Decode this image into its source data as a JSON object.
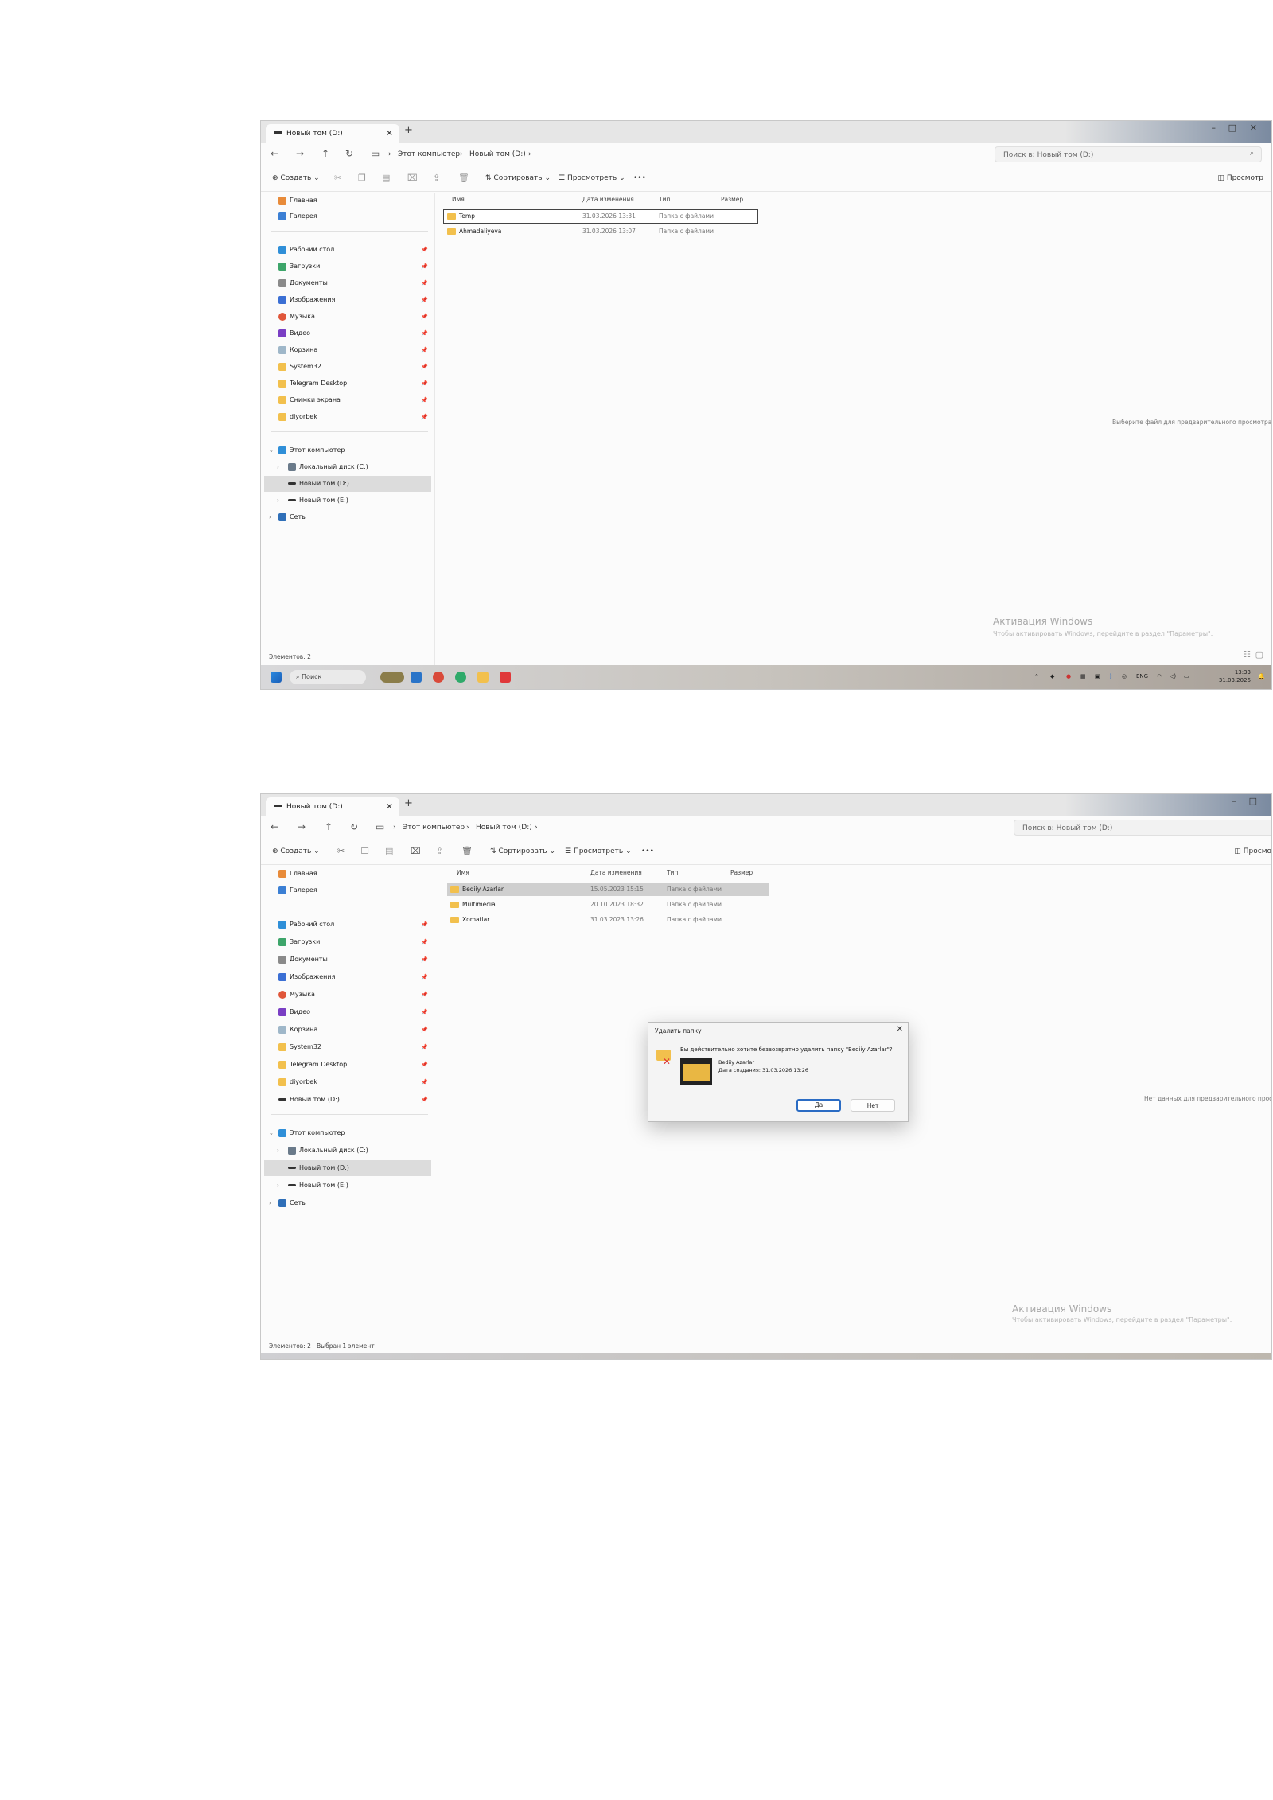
{
  "shot1": {
    "tab_title": "Новый том (D:)",
    "breadcrumb": [
      "Этот компьютер",
      "Новый том (D:)"
    ],
    "search_placeholder": "Поиск в: Новый том (D:)",
    "toolbar": {
      "create": "Создать",
      "sort": "Сортировать",
      "view": "Просмотреть",
      "more": "•••",
      "preview": "Просмотр"
    },
    "columns": {
      "name": "Имя",
      "date": "Дата изменения",
      "type": "Тип",
      "size": "Размер"
    },
    "files": [
      {
        "name": "Temp",
        "date": "31.03.2026 13:31",
        "type": "Папка с файлами"
      },
      {
        "name": "Ahmadaliyeva",
        "date": "31.03.2026 13:07",
        "type": "Папка с файлами"
      }
    ],
    "sidebar": {
      "home": "Главная",
      "gallery": "Галерея",
      "quick": [
        "Рабочий стол",
        "Загрузки",
        "Документы",
        "Изображения",
        "Музыка",
        "Видео",
        "Корзина",
        "System32",
        "Telegram Desktop",
        "Снимки экрана",
        "diyorbek"
      ],
      "this_pc": "Этот компьютер",
      "drives": [
        "Локальный диск (C:)",
        "Новый том (D:)",
        "Новый том (E:)"
      ],
      "network": "Сеть"
    },
    "preview_hint": "Выберите файл для предварительного просмотра.",
    "status": "Элементов: 2",
    "activation_title": "Активация Windows",
    "activation_sub": "Чтобы активировать Windows, перейдите в раздел \"Параметры\".",
    "taskbar": {
      "search": "Поиск",
      "lang": "ENG",
      "time": "13:33",
      "date": "31.03.2026"
    }
  },
  "shot2": {
    "tab_title": "Новый том (D:)",
    "breadcrumb": [
      "Этот компьютер",
      "Новый том (D:)"
    ],
    "search_placeholder": "Поиск в: Новый том (D:)",
    "toolbar": {
      "create": "Создать",
      "sort": "Сортировать",
      "view": "Просмотреть",
      "more": "•••",
      "preview": "Просмо"
    },
    "columns": {
      "name": "Имя",
      "date": "Дата изменения",
      "type": "Тип",
      "size": "Размер"
    },
    "files": [
      {
        "name": "Bediiy Azarlar",
        "date": "15.05.2023 15:15",
        "type": "Папка с файлами"
      },
      {
        "name": "Multimedia",
        "date": "20.10.2023 18:32",
        "type": "Папка с файлами"
      },
      {
        "name": "Xomatlar",
        "date": "31.03.2023 13:26",
        "type": "Папка с файлами"
      }
    ],
    "sidebar": {
      "home": "Главная",
      "gallery": "Галерея",
      "quick": [
        "Рабочий стол",
        "Загрузки",
        "Документы",
        "Изображения",
        "Музыка",
        "Видео",
        "Корзина",
        "System32",
        "Telegram Desktop",
        "diyorbek",
        "Новый том (D:)"
      ],
      "this_pc": "Этот компьютер",
      "drives": [
        "Локальный диск (C:)",
        "Новый том (D:)",
        "Новый том (E:)"
      ],
      "network": "Сеть"
    },
    "preview_hint": "Нет данных для предварительного просмотра.",
    "status": "Элементов: 2",
    "status_selected": "Выбран 1 элемент",
    "activation_title": "Активация Windows",
    "activation_sub": "Чтобы активировать Windows, перейдите в раздел \"Параметры\".",
    "dialog": {
      "title": "Удалить папку",
      "question": "Вы действительно хотите безвозвратно удалить папку \"Bediiy Azarlar\"?",
      "item_name": "Bediiy Azarlar",
      "item_date": "Дата создания: 31.03.2026 13:26",
      "yes": "Да",
      "no": "Нет"
    }
  },
  "colors": {
    "folder": "#f2c04d",
    "accent": "#2b6cc4",
    "selection": "#dcdcdc"
  }
}
